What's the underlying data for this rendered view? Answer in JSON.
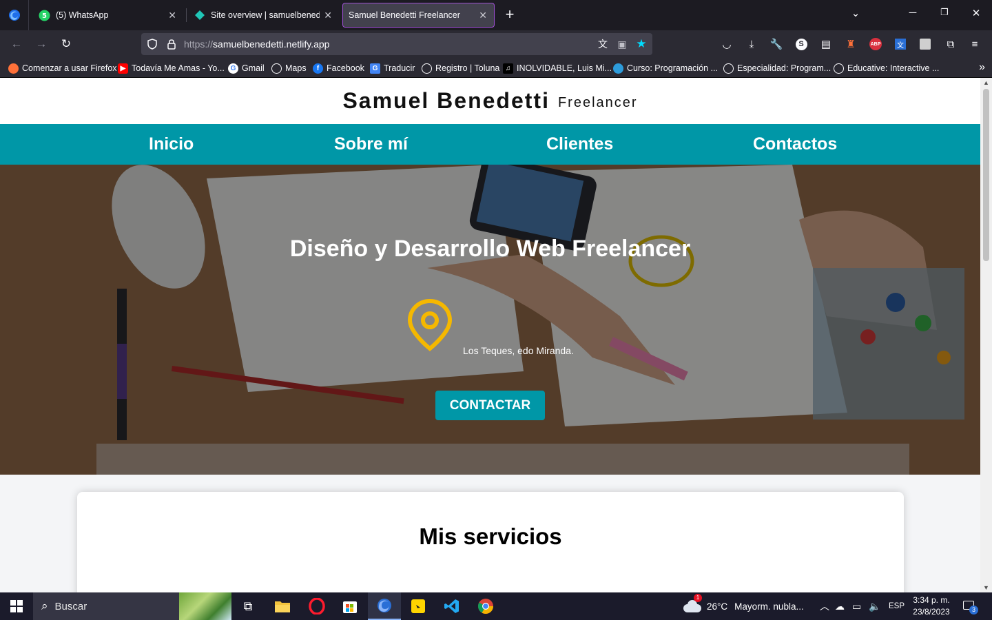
{
  "browser": {
    "tabs": [
      {
        "label": "(5) WhatsApp",
        "icon": "whatsapp-icon"
      },
      {
        "label": "Site overview | samuelbenedetti",
        "icon": "netlify-icon"
      },
      {
        "label": "Samuel Benedetti Freelancer",
        "icon": "",
        "active": true
      }
    ],
    "url_protocol": "https://",
    "url_host": "samuelbenedetti.netlify.app",
    "bookmarks": [
      {
        "label": "Comenzar a usar Firefox",
        "icon": "firefox-icon",
        "color": "#ff7139"
      },
      {
        "label": "Todavía Me Amas - Yo...",
        "icon": "youtube-icon",
        "color": "#ff0000"
      },
      {
        "label": "Gmail",
        "icon": "google-icon",
        "color": "#4285f4"
      },
      {
        "label": "Maps",
        "icon": "globe-icon",
        "color": ""
      },
      {
        "label": "Facebook",
        "icon": "facebook-icon",
        "color": "#1877f2"
      },
      {
        "label": "Traducir",
        "icon": "translate-icon",
        "color": "#4285f4"
      },
      {
        "label": "Registro | Toluna",
        "icon": "globe-icon",
        "color": ""
      },
      {
        "label": "INOLVIDABLE, Luis Mi...",
        "icon": "music-icon",
        "color": "#000000"
      },
      {
        "label": "Curso: Programación ...",
        "icon": "course-icon",
        "color": "#2d9cdb"
      },
      {
        "label": "Especialidad: Program...",
        "icon": "globe-icon",
        "color": ""
      },
      {
        "label": "Educative: Interactive ...",
        "icon": "globe-icon",
        "color": ""
      }
    ]
  },
  "site": {
    "name": "Samuel Benedetti",
    "tagline": "Freelancer",
    "nav": [
      "Inicio",
      "Sobre mí",
      "Clientes",
      "Contactos"
    ],
    "hero_title": "Diseño y Desarrollo Web Freelancer",
    "location": "Los Teques, edo Miranda.",
    "cta": "CONTACTAR",
    "services_title": "Mis servicios",
    "accent_color": "#0097a7",
    "pin_color": "#f5b800"
  },
  "taskbar": {
    "search_placeholder": "Buscar",
    "weather_temp": "26°C",
    "weather_text": "Mayorm. nubla...",
    "weather_badge": "1",
    "lang": "ESP",
    "time": "3:34 p. m.",
    "date": "23/8/2023",
    "notification_count": "3"
  }
}
